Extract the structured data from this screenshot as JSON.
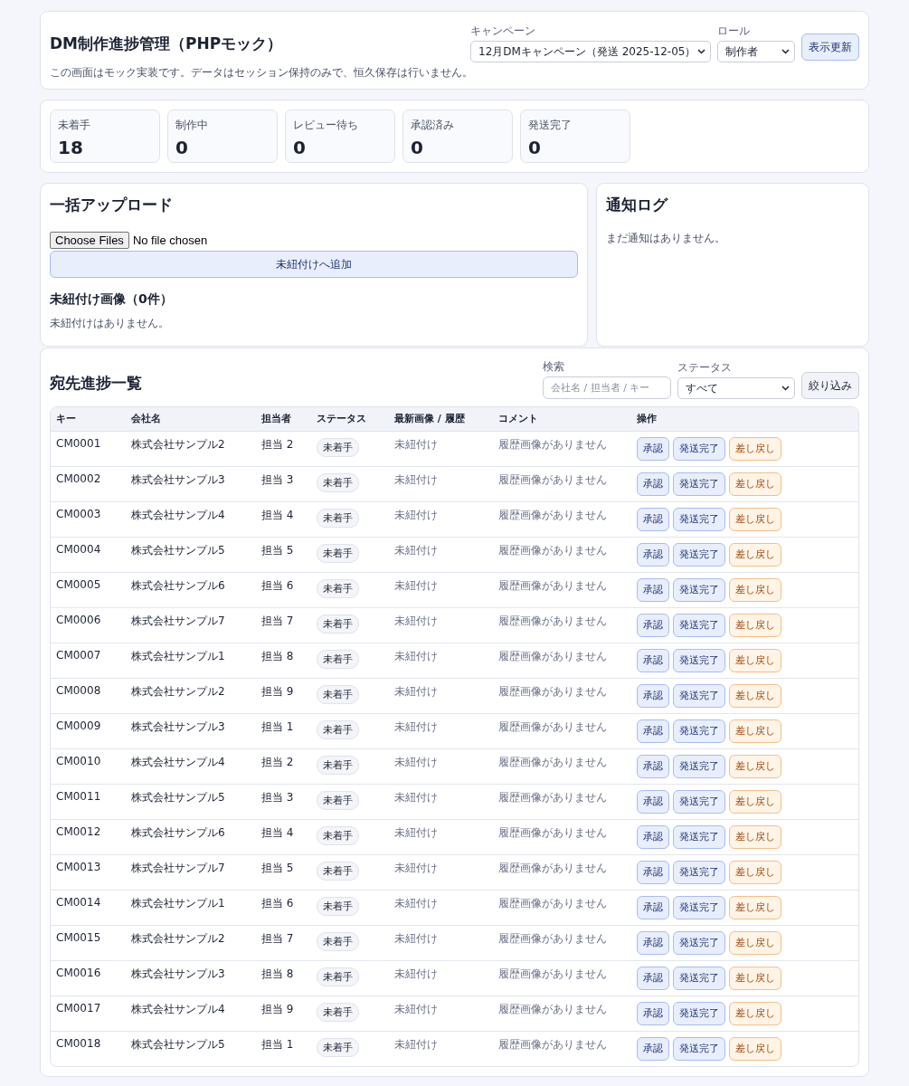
{
  "header": {
    "title": "DM制作進捗管理（PHPモック）",
    "note": "この画面はモック実装です。データはセッション保持のみで、恒久保存は行いません。",
    "campaign": {
      "label": "キャンペーン",
      "value": "12月DMキャンペーン（発送 2025-12-05）"
    },
    "role": {
      "label": "ロール",
      "value": "制作者"
    },
    "refresh_button": "表示更新"
  },
  "stats": [
    {
      "label": "未着手",
      "value": "18"
    },
    {
      "label": "制作中",
      "value": "0"
    },
    {
      "label": "レビュー待ち",
      "value": "0"
    },
    {
      "label": "承認済み",
      "value": "0"
    },
    {
      "label": "発送完了",
      "value": "0"
    }
  ],
  "upload": {
    "title": "一括アップロード",
    "choose_button": "Choose Files",
    "file_status": "No file chosen",
    "add_button": "未紐付けへ追加",
    "unlinked_title": "未紐付け画像（0件）",
    "unlinked_empty": "未紐付けはありません。"
  },
  "notifications": {
    "title": "通知ログ",
    "empty": "まだ通知はありません。"
  },
  "list": {
    "title": "宛先進捗一覧",
    "search": {
      "label": "検索",
      "placeholder": "会社名 / 担当者 / キー"
    },
    "status_filter": {
      "label": "ステータス",
      "value": "すべて"
    },
    "filter_button": "絞り込み",
    "columns": [
      "キー",
      "会社名",
      "担当者",
      "ステータス",
      "最新画像 / 履歴",
      "コメント",
      "操作"
    ],
    "rows": [
      {
        "key": "CM0001",
        "company": "株式会社サンプル2",
        "assignee": "担当 2",
        "status": "未着手",
        "latest": "未紐付け",
        "comment": "履歴画像がありません",
        "actions": [
          {
            "label": "承認",
            "kind": "primary"
          },
          {
            "label": "発送完了",
            "kind": "primary"
          },
          {
            "label": "差し戻し",
            "kind": "warn"
          }
        ]
      },
      {
        "key": "CM0002",
        "company": "株式会社サンプル3",
        "assignee": "担当 3",
        "status": "未着手",
        "latest": "未紐付け",
        "comment": "履歴画像がありません",
        "actions": [
          {
            "label": "承認",
            "kind": "primary"
          },
          {
            "label": "発送完了",
            "kind": "primary"
          },
          {
            "label": "差し戻し",
            "kind": "warn"
          }
        ]
      },
      {
        "key": "CM0003",
        "company": "株式会社サンプル4",
        "assignee": "担当 4",
        "status": "未着手",
        "latest": "未紐付け",
        "comment": "履歴画像がありません",
        "actions": [
          {
            "label": "承認",
            "kind": "primary"
          },
          {
            "label": "発送完了",
            "kind": "primary"
          },
          {
            "label": "差し戻し",
            "kind": "warn"
          }
        ]
      },
      {
        "key": "CM0004",
        "company": "株式会社サンプル5",
        "assignee": "担当 5",
        "status": "未着手",
        "latest": "未紐付け",
        "comment": "履歴画像がありません",
        "actions": [
          {
            "label": "承認",
            "kind": "primary"
          },
          {
            "label": "発送完了",
            "kind": "primary"
          },
          {
            "label": "差し戻し",
            "kind": "warn"
          }
        ]
      },
      {
        "key": "CM0005",
        "company": "株式会社サンプル6",
        "assignee": "担当 6",
        "status": "未着手",
        "latest": "未紐付け",
        "comment": "履歴画像がありません",
        "actions": [
          {
            "label": "承認",
            "kind": "primary"
          },
          {
            "label": "発送完了",
            "kind": "primary"
          },
          {
            "label": "差し戻し",
            "kind": "warn"
          }
        ]
      },
      {
        "key": "CM0006",
        "company": "株式会社サンプル7",
        "assignee": "担当 7",
        "status": "未着手",
        "latest": "未紐付け",
        "comment": "履歴画像がありません",
        "actions": [
          {
            "label": "承認",
            "kind": "primary"
          },
          {
            "label": "発送完了",
            "kind": "primary"
          },
          {
            "label": "差し戻し",
            "kind": "warn"
          }
        ]
      },
      {
        "key": "CM0007",
        "company": "株式会社サンプル1",
        "assignee": "担当 8",
        "status": "未着手",
        "latest": "未紐付け",
        "comment": "履歴画像がありません",
        "actions": [
          {
            "label": "承認",
            "kind": "primary"
          },
          {
            "label": "発送完了",
            "kind": "primary"
          },
          {
            "label": "差し戻し",
            "kind": "warn"
          }
        ]
      },
      {
        "key": "CM0008",
        "company": "株式会社サンプル2",
        "assignee": "担当 9",
        "status": "未着手",
        "latest": "未紐付け",
        "comment": "履歴画像がありません",
        "actions": [
          {
            "label": "承認",
            "kind": "primary"
          },
          {
            "label": "発送完了",
            "kind": "primary"
          },
          {
            "label": "差し戻し",
            "kind": "warn"
          }
        ]
      },
      {
        "key": "CM0009",
        "company": "株式会社サンプル3",
        "assignee": "担当 1",
        "status": "未着手",
        "latest": "未紐付け",
        "comment": "履歴画像がありません",
        "actions": [
          {
            "label": "承認",
            "kind": "primary"
          },
          {
            "label": "発送完了",
            "kind": "primary"
          },
          {
            "label": "差し戻し",
            "kind": "warn"
          }
        ]
      },
      {
        "key": "CM0010",
        "company": "株式会社サンプル4",
        "assignee": "担当 2",
        "status": "未着手",
        "latest": "未紐付け",
        "comment": "履歴画像がありません",
        "actions": [
          {
            "label": "承認",
            "kind": "primary"
          },
          {
            "label": "発送完了",
            "kind": "primary"
          },
          {
            "label": "差し戻し",
            "kind": "warn"
          }
        ]
      },
      {
        "key": "CM0011",
        "company": "株式会社サンプル5",
        "assignee": "担当 3",
        "status": "未着手",
        "latest": "未紐付け",
        "comment": "履歴画像がありません",
        "actions": [
          {
            "label": "承認",
            "kind": "primary"
          },
          {
            "label": "発送完了",
            "kind": "primary"
          },
          {
            "label": "差し戻し",
            "kind": "warn"
          }
        ]
      },
      {
        "key": "CM0012",
        "company": "株式会社サンプル6",
        "assignee": "担当 4",
        "status": "未着手",
        "latest": "未紐付け",
        "comment": "履歴画像がありません",
        "actions": [
          {
            "label": "承認",
            "kind": "primary"
          },
          {
            "label": "発送完了",
            "kind": "primary"
          },
          {
            "label": "差し戻し",
            "kind": "warn"
          }
        ]
      },
      {
        "key": "CM0013",
        "company": "株式会社サンプル7",
        "assignee": "担当 5",
        "status": "未着手",
        "latest": "未紐付け",
        "comment": "履歴画像がありません",
        "actions": [
          {
            "label": "承認",
            "kind": "primary"
          },
          {
            "label": "発送完了",
            "kind": "primary"
          },
          {
            "label": "差し戻し",
            "kind": "warn"
          }
        ]
      },
      {
        "key": "CM0014",
        "company": "株式会社サンプル1",
        "assignee": "担当 6",
        "status": "未着手",
        "latest": "未紐付け",
        "comment": "履歴画像がありません",
        "actions": [
          {
            "label": "承認",
            "kind": "primary"
          },
          {
            "label": "発送完了",
            "kind": "primary"
          },
          {
            "label": "差し戻し",
            "kind": "warn"
          }
        ]
      },
      {
        "key": "CM0015",
        "company": "株式会社サンプル2",
        "assignee": "担当 7",
        "status": "未着手",
        "latest": "未紐付け",
        "comment": "履歴画像がありません",
        "actions": [
          {
            "label": "承認",
            "kind": "primary"
          },
          {
            "label": "発送完了",
            "kind": "primary"
          },
          {
            "label": "差し戻し",
            "kind": "warn"
          }
        ]
      },
      {
        "key": "CM0016",
        "company": "株式会社サンプル3",
        "assignee": "担当 8",
        "status": "未着手",
        "latest": "未紐付け",
        "comment": "履歴画像がありません",
        "actions": [
          {
            "label": "承認",
            "kind": "primary"
          },
          {
            "label": "発送完了",
            "kind": "primary"
          },
          {
            "label": "差し戻し",
            "kind": "warn"
          }
        ]
      },
      {
        "key": "CM0017",
        "company": "株式会社サンプル4",
        "assignee": "担当 9",
        "status": "未着手",
        "latest": "未紐付け",
        "comment": "履歴画像がありません",
        "actions": [
          {
            "label": "承認",
            "kind": "primary"
          },
          {
            "label": "発送完了",
            "kind": "primary"
          },
          {
            "label": "差し戻し",
            "kind": "warn"
          }
        ]
      },
      {
        "key": "CM0018",
        "company": "株式会社サンプル5",
        "assignee": "担当 1",
        "status": "未着手",
        "latest": "未紐付け",
        "comment": "履歴画像がありません",
        "actions": [
          {
            "label": "承認",
            "kind": "primary"
          },
          {
            "label": "発送完了",
            "kind": "primary"
          },
          {
            "label": "差し戻し",
            "kind": "warn"
          }
        ]
      }
    ]
  }
}
